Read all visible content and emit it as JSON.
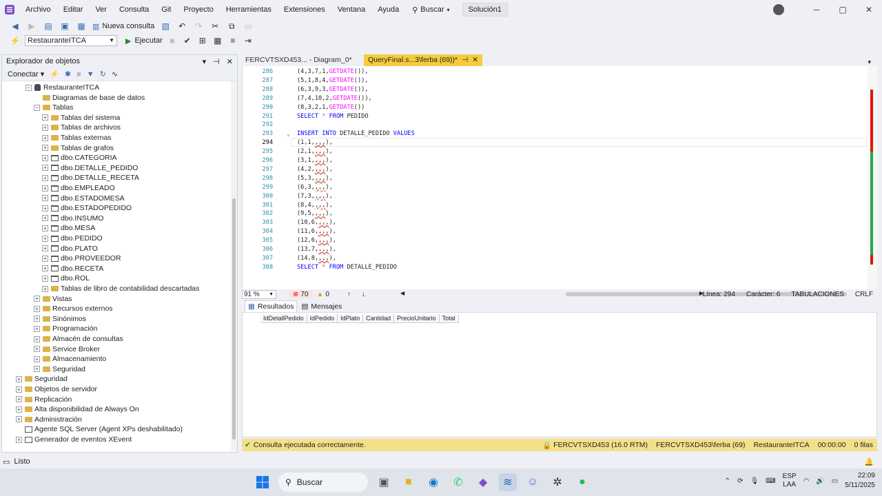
{
  "menu": {
    "items": [
      "Archivo",
      "Editar",
      "Ver",
      "Consulta",
      "Git",
      "Proyecto",
      "Herramientas",
      "Extensiones",
      "Ventana",
      "Ayuda"
    ],
    "search_label": "Buscar",
    "solution_label": "Solución1"
  },
  "toolbar": {
    "new_query_label": "Nueva consulta",
    "database_value": "RestauranteITCA",
    "execute_label": "Ejecutar"
  },
  "explorer": {
    "title": "Explorador de objetos",
    "connect_label": "Conectar",
    "tree": [
      {
        "label": "RestauranteITCA",
        "level": 0,
        "icon": "database-icon",
        "expander": "−"
      },
      {
        "label": "Diagramas de base de datos",
        "level": 1,
        "icon": "folder-icon",
        "expander": ""
      },
      {
        "label": "Tablas",
        "level": 1,
        "icon": "folder-icon",
        "expander": "−"
      },
      {
        "label": "Tablas del sistema",
        "level": 2,
        "icon": "folder-icon",
        "expander": "+"
      },
      {
        "label": "Tablas de archivos",
        "level": 2,
        "icon": "folder-icon",
        "expander": "+"
      },
      {
        "label": "Tablas externas",
        "level": 2,
        "icon": "folder-icon",
        "expander": "+"
      },
      {
        "label": "Tablas de grafos",
        "level": 2,
        "icon": "folder-icon",
        "expander": "+"
      },
      {
        "label": "dbo.CATEGORIA",
        "level": 2,
        "icon": "table-icon",
        "expander": "+"
      },
      {
        "label": "dbo.DETALLE_PEDIDO",
        "level": 2,
        "icon": "table-icon",
        "expander": "+"
      },
      {
        "label": "dbo.DETALLE_RECETA",
        "level": 2,
        "icon": "table-icon",
        "expander": "+"
      },
      {
        "label": "dbo.EMPLEADO",
        "level": 2,
        "icon": "table-icon",
        "expander": "+"
      },
      {
        "label": "dbo.ESTADOMESA",
        "level": 2,
        "icon": "table-icon",
        "expander": "+"
      },
      {
        "label": "dbo.ESTADOPEDIDO",
        "level": 2,
        "icon": "table-icon",
        "expander": "+"
      },
      {
        "label": "dbo.INSUMO",
        "level": 2,
        "icon": "table-icon",
        "expander": "+"
      },
      {
        "label": "dbo.MESA",
        "level": 2,
        "icon": "table-icon",
        "expander": "+"
      },
      {
        "label": "dbo.PEDIDO",
        "level": 2,
        "icon": "table-icon",
        "expander": "+"
      },
      {
        "label": "dbo.PLATO",
        "level": 2,
        "icon": "table-icon",
        "expander": "+"
      },
      {
        "label": "dbo.PROVEEDOR",
        "level": 2,
        "icon": "table-icon",
        "expander": "+"
      },
      {
        "label": "dbo.RECETA",
        "level": 2,
        "icon": "table-icon",
        "expander": "+"
      },
      {
        "label": "dbo.ROL",
        "level": 2,
        "icon": "table-icon",
        "expander": "+"
      },
      {
        "label": "Tablas de libro de contabilidad descartadas",
        "level": 2,
        "icon": "folder-icon",
        "expander": "+"
      },
      {
        "label": "Vistas",
        "level": 1,
        "icon": "folder-icon",
        "expander": "+"
      },
      {
        "label": "Recursos externos",
        "level": 1,
        "icon": "folder-icon",
        "expander": "+"
      },
      {
        "label": "Sinónimos",
        "level": 1,
        "icon": "folder-icon",
        "expander": "+"
      },
      {
        "label": "Programación",
        "level": 1,
        "icon": "folder-icon",
        "expander": "+"
      },
      {
        "label": "Almacén de consultas",
        "level": 1,
        "icon": "folder-icon",
        "expander": "+"
      },
      {
        "label": "Service Broker",
        "level": 1,
        "icon": "folder-icon",
        "expander": "+"
      },
      {
        "label": "Almacenamiento",
        "level": 1,
        "icon": "folder-icon",
        "expander": "+"
      },
      {
        "label": "Seguridad",
        "level": 1,
        "icon": "folder-icon",
        "expander": "+"
      },
      {
        "label": "Seguridad",
        "level": -1,
        "icon": "folder-icon",
        "expander": "+"
      },
      {
        "label": "Objetos de servidor",
        "level": -1,
        "icon": "folder-icon",
        "expander": "+"
      },
      {
        "label": "Replicación",
        "level": -1,
        "icon": "folder-icon",
        "expander": "+"
      },
      {
        "label": "Alta disponibilidad de Always On",
        "level": -1,
        "icon": "folder-icon",
        "expander": "+"
      },
      {
        "label": "Administración",
        "level": -1,
        "icon": "folder-icon",
        "expander": "+"
      },
      {
        "label": "Agente SQL Server (Agent XPs deshabilitado)",
        "level": -1,
        "icon": "agent-icon",
        "expander": ""
      },
      {
        "label": "Generador de eventos XEvent",
        "level": -1,
        "icon": "xevent-icon",
        "expander": "+"
      }
    ]
  },
  "tabs": [
    {
      "label": "FERCVTSXD453... - Diagram_0*",
      "active": false
    },
    {
      "label": "QueryFinal.s...3\\ferba (69))*",
      "active": true
    }
  ],
  "editor": {
    "current_line": "294",
    "lines": [
      {
        "n": "286",
        "code": "(4,3,7,1,GETDATE()),"
      },
      {
        "n": "287",
        "code": "(5,1,8,4,GETDATE()),"
      },
      {
        "n": "288",
        "code": "(6,3,9,3,GETDATE()),"
      },
      {
        "n": "289",
        "code": "(7,4,10,2,GETDATE()),"
      },
      {
        "n": "290",
        "code": "(8,3,2,1,GETDATE())"
      },
      {
        "n": "291",
        "code": "SELECT * FROM PEDIDO"
      },
      {
        "n": "292",
        "code": ""
      },
      {
        "n": "293",
        "code": "INSERT INTO DETALLE_PEDIDO VALUES"
      },
      {
        "n": "294",
        "code": "(1,1,,,,),"
      },
      {
        "n": "295",
        "code": "(2,1,,,,),"
      },
      {
        "n": "296",
        "code": "(3,1,,,,),"
      },
      {
        "n": "297",
        "code": "(4,2,,,,),"
      },
      {
        "n": "298",
        "code": "(5,3,,,,),"
      },
      {
        "n": "299",
        "code": "(6,3,,,,),"
      },
      {
        "n": "300",
        "code": "(7,3,,,,),"
      },
      {
        "n": "301",
        "code": "(8,4,,,,),"
      },
      {
        "n": "302",
        "code": "(9,5,,,,),"
      },
      {
        "n": "303",
        "code": "(10,6,,,,),"
      },
      {
        "n": "304",
        "code": "(11,6,,,,),"
      },
      {
        "n": "305",
        "code": "(12,6,,,,),"
      },
      {
        "n": "306",
        "code": "(13,7,,,,),"
      },
      {
        "n": "307",
        "code": "(14,8,,,,),"
      },
      {
        "n": "308",
        "code": "SELECT * FROM DETALLE_PEDIDO"
      }
    ]
  },
  "editor_status": {
    "zoom": "91 %",
    "errors": "70",
    "warnings": "0",
    "line": "Línea: 294",
    "char": "Carácter: 6",
    "tabs": "TABULACIONES",
    "eol": "CRLF"
  },
  "results": {
    "tab_results": "Resultados",
    "tab_messages": "Mensajes",
    "columns": [
      "IdDetallPedido",
      "IdPedido",
      "IdPlato",
      "Cantidad",
      "PrecioUnitario",
      "Total"
    ]
  },
  "query_status": {
    "message": "Consulta ejecutada correctamente.",
    "server": "FERCVTSXD453 (16.0 RTM)",
    "user": "FERCVTSXD453\\ferba (69)",
    "database": "RestauranteITCA",
    "time": "00:00:00",
    "rows": "0 filas"
  },
  "app_status": "Listo",
  "taskbar": {
    "search_label": "Buscar",
    "lang1": "ESP",
    "lang2": "LAA",
    "time": "22:09",
    "date": "5/11/2025"
  },
  "colors": {
    "active_tab": "#f5cc3d",
    "status_bar": "#f5e08a",
    "keyword": "#0000ff",
    "function": "#ff00ff",
    "line_number": "#2b91af"
  }
}
